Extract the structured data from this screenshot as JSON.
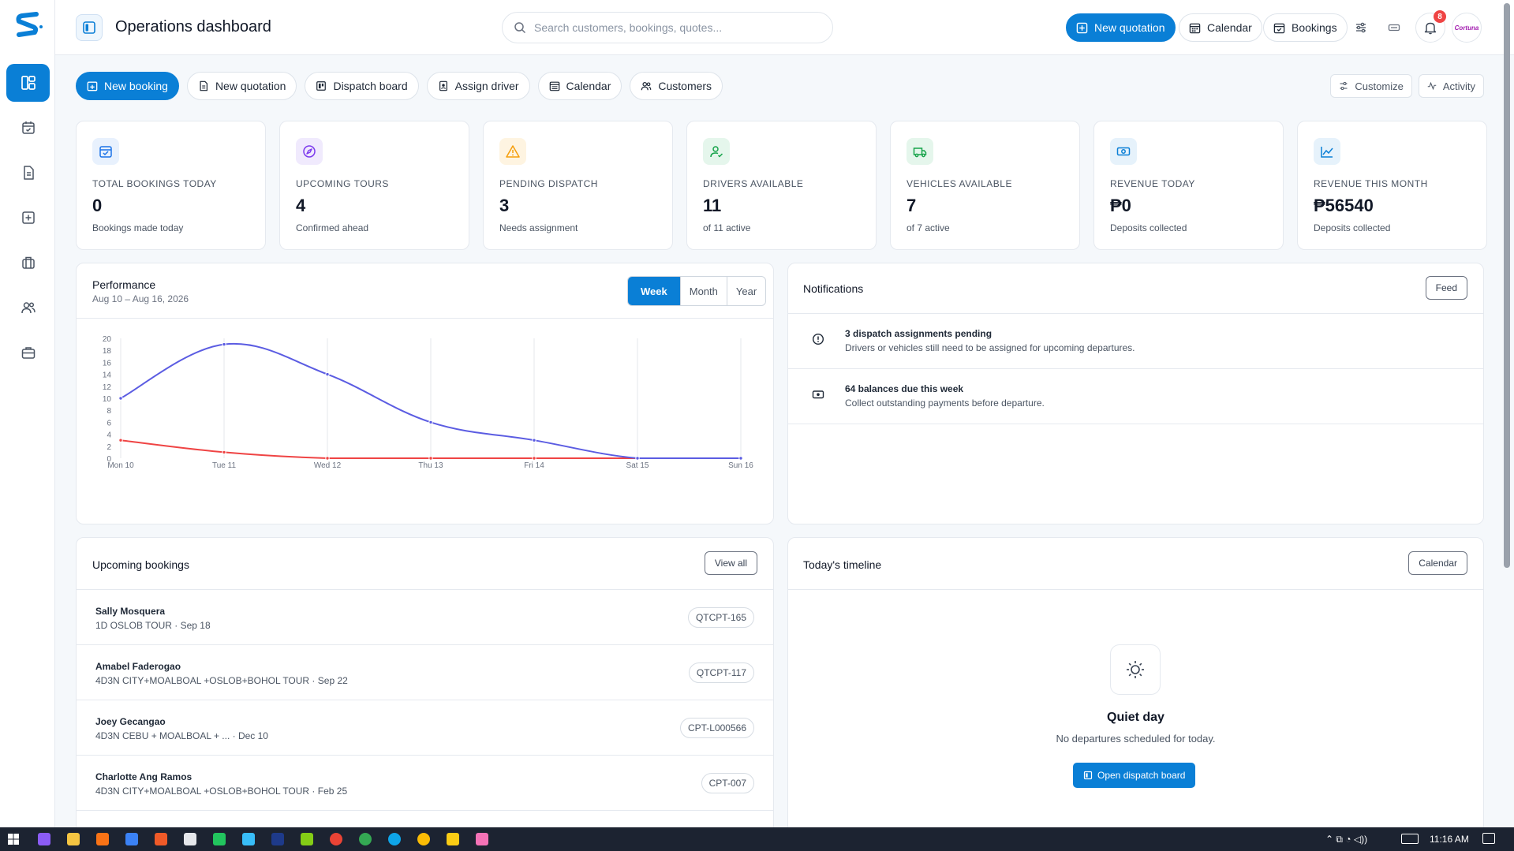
{
  "header": {
    "title": "Operations dashboard",
    "search_placeholder": "Search customers, bookings, quotes...",
    "new_quotation": "New quotation",
    "calendar": "Calendar",
    "bookings": "Bookings",
    "notification_count": "8",
    "avatar_text": "Cortuna"
  },
  "actions": [
    {
      "label": "New booking"
    },
    {
      "label": "New quotation"
    },
    {
      "label": "Dispatch board"
    },
    {
      "label": "Assign driver"
    },
    {
      "label": "Calendar"
    },
    {
      "label": "Customers"
    }
  ],
  "right_actions": {
    "customize": "Customize",
    "activity": "Activity"
  },
  "stats": [
    {
      "label": "TOTAL BOOKINGS TODAY",
      "value": "0",
      "sub": "Bookings made today",
      "icon": "calendar-check-icon",
      "color": "#1a73e8"
    },
    {
      "label": "UPCOMING TOURS",
      "value": "4",
      "sub": "Confirmed ahead",
      "icon": "compass-icon",
      "color": "#7c3aed"
    },
    {
      "label": "PENDING DISPATCH",
      "value": "3",
      "sub": "Needs assignment",
      "icon": "warning-icon",
      "color": "#f59e0b"
    },
    {
      "label": "DRIVERS AVAILABLE",
      "value": "11",
      "sub": "of 11 active",
      "icon": "user-check-icon",
      "color": "#16a34a"
    },
    {
      "label": "VEHICLES AVAILABLE",
      "value": "7",
      "sub": "of 7 active",
      "icon": "truck-icon",
      "color": "#16a34a"
    },
    {
      "label": "REVENUE TODAY",
      "value": "₱0",
      "sub": "Deposits collected",
      "icon": "cash-icon",
      "color": "#0a7fd6"
    },
    {
      "label": "REVENUE THIS MONTH",
      "value": "₱56540",
      "sub": "Deposits collected",
      "icon": "trend-icon",
      "color": "#0a7fd6"
    }
  ],
  "performance": {
    "title": "Performance",
    "range": "Aug 10 – Aug 16, 2026",
    "tabs": [
      "Week",
      "Month",
      "Year"
    ],
    "active_tab": "Week"
  },
  "chart_data": {
    "type": "line",
    "categories": [
      "Mon 10",
      "Tue 11",
      "Wed 12",
      "Thu 13",
      "Fri 14",
      "Sat 15",
      "Sun 16"
    ],
    "series": [
      {
        "values": [
          10,
          19,
          14,
          6,
          3,
          0,
          0
        ],
        "color": "#5b5ce2"
      },
      {
        "values": [
          3,
          1,
          0,
          0,
          0,
          0,
          0
        ],
        "color": "#ef4444"
      }
    ],
    "yticks": [
      0,
      2,
      4,
      6,
      8,
      10,
      12,
      14,
      16,
      18,
      20
    ],
    "ylim": [
      0,
      20
    ],
    "grid": "vertical"
  },
  "notifications": {
    "title": "Notifications",
    "feed": "Feed",
    "items": [
      {
        "title": "3 dispatch assignments pending",
        "desc": "Drivers or vehicles still need to be assigned for upcoming departures.",
        "icon": "alert-circle-icon"
      },
      {
        "title": "64 balances due this week",
        "desc": "Collect outstanding payments before departure.",
        "icon": "cash-icon"
      }
    ]
  },
  "upcoming": {
    "title": "Upcoming bookings",
    "view_all": "View all",
    "items": [
      {
        "name": "Sally Mosquera",
        "sub": "1D OSLOB TOUR · Sep 18",
        "code": "QTCPT-165"
      },
      {
        "name": "Amabel Faderogao",
        "sub": "4D3N CITY+MOALBOAL +OSLOB+BOHOL TOUR · Sep 22",
        "code": "QTCPT-117"
      },
      {
        "name": "Joey Gecangao",
        "sub": "4D3N CEBU + MOALBOAL + ... · Dec 10",
        "code": "CPT-L000566"
      },
      {
        "name": "Charlotte Ang Ramos",
        "sub": "4D3N CITY+MOALBOAL +OSLOB+BOHOL TOUR · Feb 25",
        "code": "CPT-007"
      }
    ]
  },
  "timeline": {
    "title": "Today's timeline",
    "calendar": "Calendar",
    "empty_title": "Quiet day",
    "empty_desc": "No departures scheduled for today.",
    "cta": "Open dispatch board"
  },
  "taskbar": {
    "time": "11:16 AM"
  }
}
